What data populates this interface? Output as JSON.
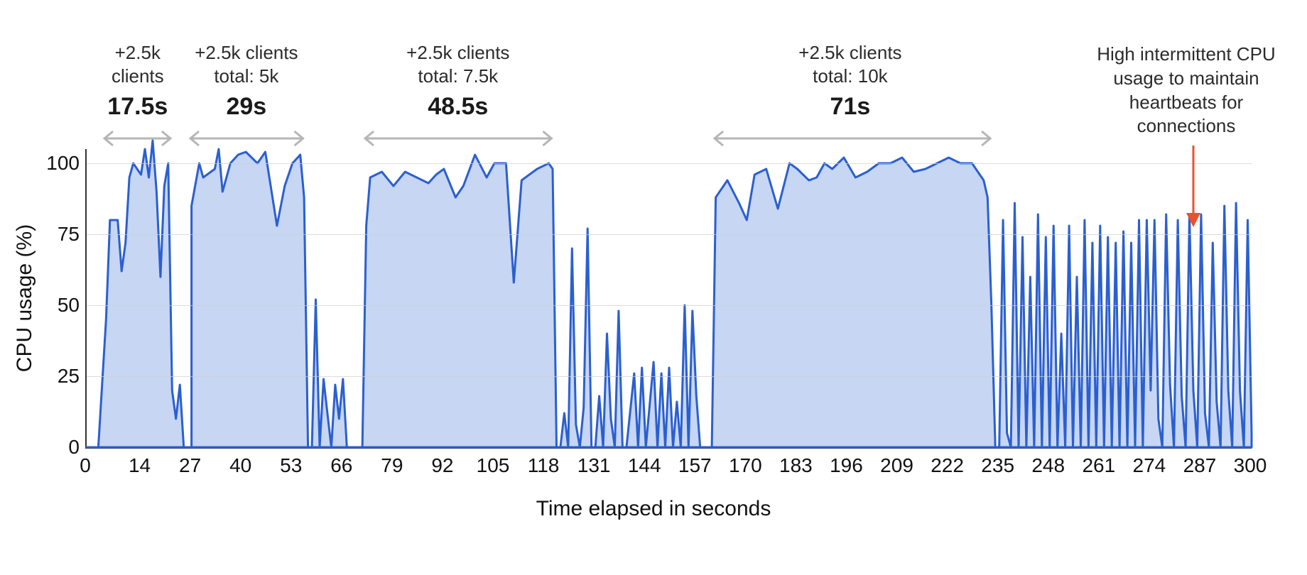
{
  "chart_data": {
    "type": "area",
    "xlabel": "Time elapsed in seconds",
    "ylabel": "CPU usage (%)",
    "xlim": [
      0,
      300
    ],
    "ylim": [
      0,
      105
    ],
    "grid_y": [
      25,
      50,
      75,
      100
    ],
    "x_ticks": [
      0,
      14,
      27,
      40,
      53,
      66,
      79,
      92,
      105,
      118,
      131,
      144,
      157,
      170,
      183,
      196,
      209,
      222,
      235,
      248,
      261,
      274,
      287,
      300
    ],
    "y_ticks": [
      0,
      25,
      50,
      75,
      100
    ],
    "series": [
      {
        "name": "CPU",
        "stroke": "#2b5fd1",
        "fill": "#c6d6f3",
        "data": [
          [
            0,
            0
          ],
          [
            3,
            0
          ],
          [
            5,
            45
          ],
          [
            6,
            80
          ],
          [
            8,
            80
          ],
          [
            9,
            62
          ],
          [
            10,
            72
          ],
          [
            11,
            95
          ],
          [
            12,
            100
          ],
          [
            14,
            96
          ],
          [
            15,
            105
          ],
          [
            16,
            95
          ],
          [
            17,
            108
          ],
          [
            18,
            90
          ],
          [
            19,
            60
          ],
          [
            20,
            92
          ],
          [
            21,
            100
          ],
          [
            22,
            20
          ],
          [
            23,
            10
          ],
          [
            24,
            22
          ],
          [
            25,
            0
          ],
          [
            26,
            0
          ],
          [
            27,
            0
          ],
          [
            27,
            85
          ],
          [
            29,
            100
          ],
          [
            30,
            95
          ],
          [
            33,
            98
          ],
          [
            34,
            105
          ],
          [
            35,
            90
          ],
          [
            37,
            100
          ],
          [
            39,
            103
          ],
          [
            41,
            104
          ],
          [
            44,
            100
          ],
          [
            46,
            104
          ],
          [
            49,
            78
          ],
          [
            51,
            92
          ],
          [
            53,
            100
          ],
          [
            55,
            103
          ],
          [
            56,
            88
          ],
          [
            57,
            0
          ],
          [
            58,
            0
          ],
          [
            59,
            52
          ],
          [
            60,
            0
          ],
          [
            61,
            24
          ],
          [
            62,
            12
          ],
          [
            63,
            0
          ],
          [
            64,
            22
          ],
          [
            65,
            10
          ],
          [
            66,
            24
          ],
          [
            67,
            0
          ],
          [
            68,
            0
          ],
          [
            69,
            0
          ],
          [
            70,
            0
          ],
          [
            71,
            0
          ],
          [
            72,
            78
          ],
          [
            73,
            95
          ],
          [
            76,
            97
          ],
          [
            79,
            92
          ],
          [
            82,
            97
          ],
          [
            85,
            95
          ],
          [
            88,
            93
          ],
          [
            90,
            96
          ],
          [
            92,
            98
          ],
          [
            95,
            88
          ],
          [
            97,
            92
          ],
          [
            100,
            103
          ],
          [
            103,
            95
          ],
          [
            105,
            100
          ],
          [
            108,
            100
          ],
          [
            110,
            58
          ],
          [
            112,
            94
          ],
          [
            114,
            96
          ],
          [
            116,
            98
          ],
          [
            119,
            100
          ],
          [
            120,
            98
          ],
          [
            121,
            0
          ],
          [
            122,
            0
          ],
          [
            123,
            12
          ],
          [
            124,
            0
          ],
          [
            125,
            70
          ],
          [
            126,
            8
          ],
          [
            127,
            0
          ],
          [
            128,
            14
          ],
          [
            129,
            77
          ],
          [
            130,
            0
          ],
          [
            131,
            0
          ],
          [
            132,
            18
          ],
          [
            133,
            0
          ],
          [
            134,
            40
          ],
          [
            135,
            10
          ],
          [
            136,
            0
          ],
          [
            137,
            48
          ],
          [
            138,
            0
          ],
          [
            139,
            0
          ],
          [
            141,
            26
          ],
          [
            142,
            0
          ],
          [
            143,
            28
          ],
          [
            144,
            0
          ],
          [
            146,
            30
          ],
          [
            147,
            0
          ],
          [
            148,
            26
          ],
          [
            149,
            0
          ],
          [
            150,
            28
          ],
          [
            151,
            0
          ],
          [
            152,
            16
          ],
          [
            153,
            0
          ],
          [
            154,
            50
          ],
          [
            155,
            0
          ],
          [
            156,
            48
          ],
          [
            157,
            18
          ],
          [
            158,
            0
          ],
          [
            159,
            0
          ],
          [
            160,
            0
          ],
          [
            161,
            0
          ],
          [
            162,
            88
          ],
          [
            165,
            94
          ],
          [
            168,
            86
          ],
          [
            170,
            80
          ],
          [
            172,
            96
          ],
          [
            175,
            98
          ],
          [
            178,
            84
          ],
          [
            181,
            100
          ],
          [
            183,
            98
          ],
          [
            186,
            94
          ],
          [
            188,
            95
          ],
          [
            190,
            100
          ],
          [
            192,
            98
          ],
          [
            195,
            102
          ],
          [
            198,
            95
          ],
          [
            201,
            97
          ],
          [
            204,
            100
          ],
          [
            207,
            100
          ],
          [
            210,
            102
          ],
          [
            213,
            97
          ],
          [
            216,
            98
          ],
          [
            219,
            100
          ],
          [
            222,
            102
          ],
          [
            225,
            100
          ],
          [
            228,
            100
          ],
          [
            231,
            94
          ],
          [
            232,
            88
          ],
          [
            233,
            50
          ],
          [
            234,
            0
          ],
          [
            235,
            0
          ],
          [
            236,
            80
          ],
          [
            237,
            5
          ],
          [
            238,
            0
          ],
          [
            239,
            86
          ],
          [
            240,
            0
          ],
          [
            241,
            74
          ],
          [
            242,
            0
          ],
          [
            243,
            60
          ],
          [
            244,
            0
          ],
          [
            245,
            82
          ],
          [
            246,
            0
          ],
          [
            247,
            74
          ],
          [
            248,
            0
          ],
          [
            249,
            78
          ],
          [
            250,
            0
          ],
          [
            251,
            40
          ],
          [
            252,
            0
          ],
          [
            253,
            78
          ],
          [
            254,
            0
          ],
          [
            255,
            60
          ],
          [
            256,
            0
          ],
          [
            257,
            80
          ],
          [
            258,
            0
          ],
          [
            259,
            72
          ],
          [
            260,
            0
          ],
          [
            261,
            78
          ],
          [
            262,
            0
          ],
          [
            263,
            74
          ],
          [
            264,
            0
          ],
          [
            265,
            72
          ],
          [
            266,
            0
          ],
          [
            267,
            76
          ],
          [
            268,
            0
          ],
          [
            269,
            72
          ],
          [
            270,
            0
          ],
          [
            271,
            80
          ],
          [
            272,
            0
          ],
          [
            273,
            80
          ],
          [
            274,
            20
          ],
          [
            275,
            80
          ],
          [
            276,
            10
          ],
          [
            277,
            0
          ],
          [
            278,
            82
          ],
          [
            279,
            22
          ],
          [
            280,
            0
          ],
          [
            281,
            80
          ],
          [
            282,
            18
          ],
          [
            283,
            0
          ],
          [
            284,
            82
          ],
          [
            285,
            20
          ],
          [
            286,
            0
          ],
          [
            287,
            82
          ],
          [
            288,
            12
          ],
          [
            289,
            0
          ],
          [
            290,
            72
          ],
          [
            291,
            16
          ],
          [
            292,
            0
          ],
          [
            293,
            85
          ],
          [
            294,
            20
          ],
          [
            295,
            0
          ],
          [
            296,
            86
          ],
          [
            297,
            20
          ],
          [
            298,
            0
          ],
          [
            299,
            80
          ],
          [
            300,
            5
          ]
        ]
      }
    ],
    "annotations": [
      {
        "label_top": "+2.5k\nclients",
        "duration": "17.5s",
        "center": 13.5,
        "span": [
          5,
          22
        ]
      },
      {
        "label_top": "+2.5k clients\ntotal: 5k",
        "duration": "29s",
        "center": 41.5,
        "span": [
          27,
          56
        ]
      },
      {
        "label_top": "+2.5k clients\ntotal: 7.5k",
        "duration": "48.5s",
        "center": 96,
        "span": [
          72,
          120
        ]
      },
      {
        "label_top": "+2.5k clients\ntotal: 10k",
        "duration": "71s",
        "center": 197,
        "span": [
          162,
          233
        ]
      }
    ],
    "note": "High intermittent CPU usage to maintain heartbeats for connections",
    "note_points_to_x": 274,
    "colors": {
      "stroke": "#2b5fd1",
      "fill": "#c6d6f3",
      "arrow": "#b6b6b6",
      "pointer": "#e8532b"
    }
  }
}
